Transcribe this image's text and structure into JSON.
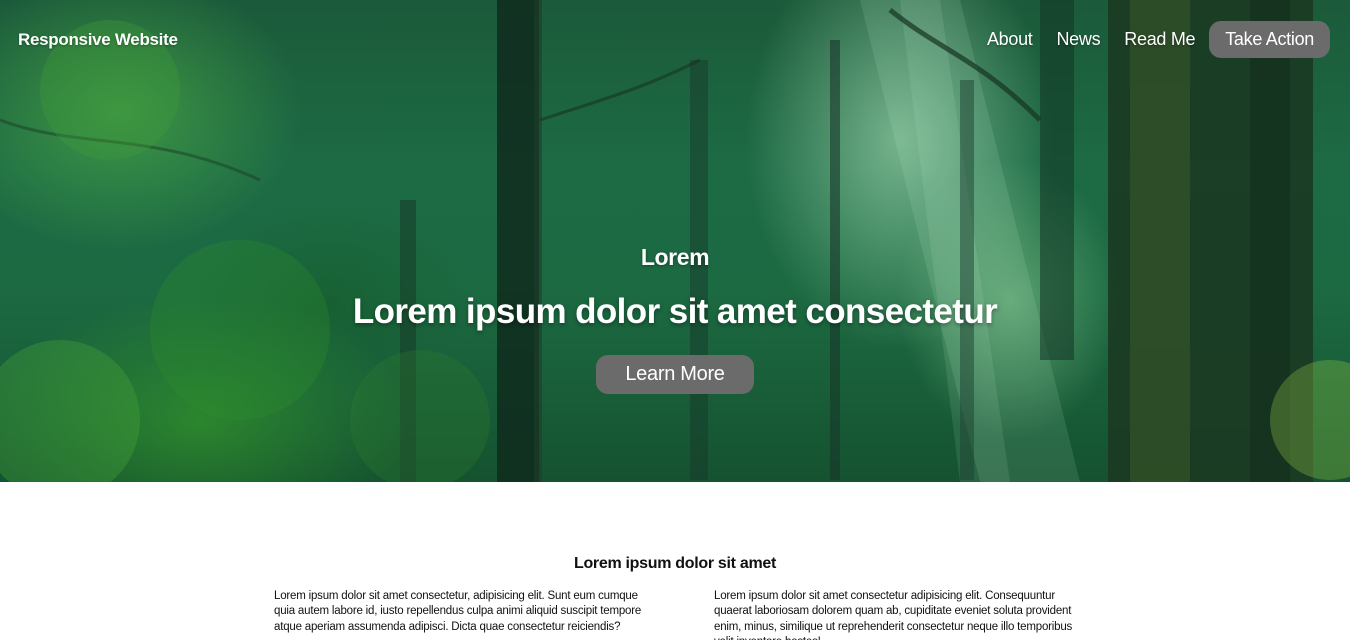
{
  "nav": {
    "brand": "Responsive Website",
    "links": [
      "About",
      "News",
      "Read Me"
    ],
    "cta": "Take Action"
  },
  "hero": {
    "eyebrow": "Lorem",
    "title": "Lorem ipsum dolor sit amet consectetur",
    "button": "Learn More"
  },
  "section": {
    "title": "Lorem ipsum dolor sit amet",
    "columns": [
      "Lorem ipsum dolor sit amet consectetur, adipisicing elit. Sunt eum cumque quia autem labore id, iusto repellendus culpa animi aliquid suscipit tempore atque aperiam assumenda adipisci. Dicta quae consectetur reiciendis?",
      "Lorem ipsum dolor sit amet consectetur adipisicing elit. Consequuntur quaerat laboriosam dolorem quam ab, cupiditate eveniet soluta provident enim, minus, similique ut reprehenderit consectetur neque illo temporibus velit inventore hostes!"
    ]
  },
  "colors": {
    "button_bg": "#6b6b6b",
    "text_light": "#ffffff",
    "text_dark": "#111111"
  }
}
